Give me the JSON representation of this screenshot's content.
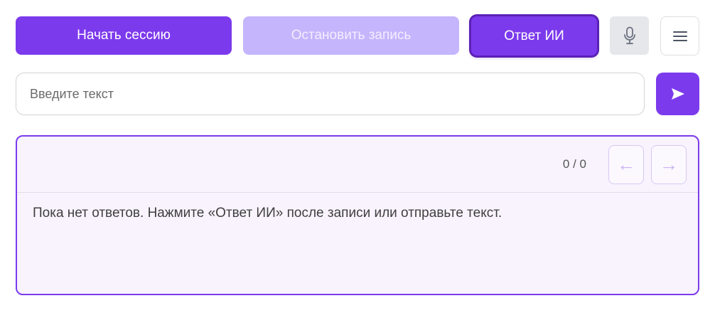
{
  "toolbar": {
    "start_label": "Начать сессию",
    "stop_label": "Остановить запись",
    "ai_label": "Ответ ИИ",
    "mic_icon": "microphone-icon",
    "menu_icon": "hamburger-menu-icon"
  },
  "composer": {
    "placeholder": "Введите текст",
    "value": "",
    "send_icon": "send-icon"
  },
  "answers": {
    "counter": "0 / 0",
    "prev_icon": "arrow-left-icon",
    "prev_glyph": "←",
    "next_icon": "arrow-right-icon",
    "next_glyph": "→",
    "empty_message": "Пока нет ответов. Нажмите «Ответ ИИ» после записи или отправьте текст."
  },
  "colors": {
    "accent": "#7c3aed",
    "accent_disabled": "#c4b5fd",
    "accent_dark": "#5b21b6",
    "panel_background": "#f8f3fd",
    "mic_background": "#e5e7eb"
  }
}
